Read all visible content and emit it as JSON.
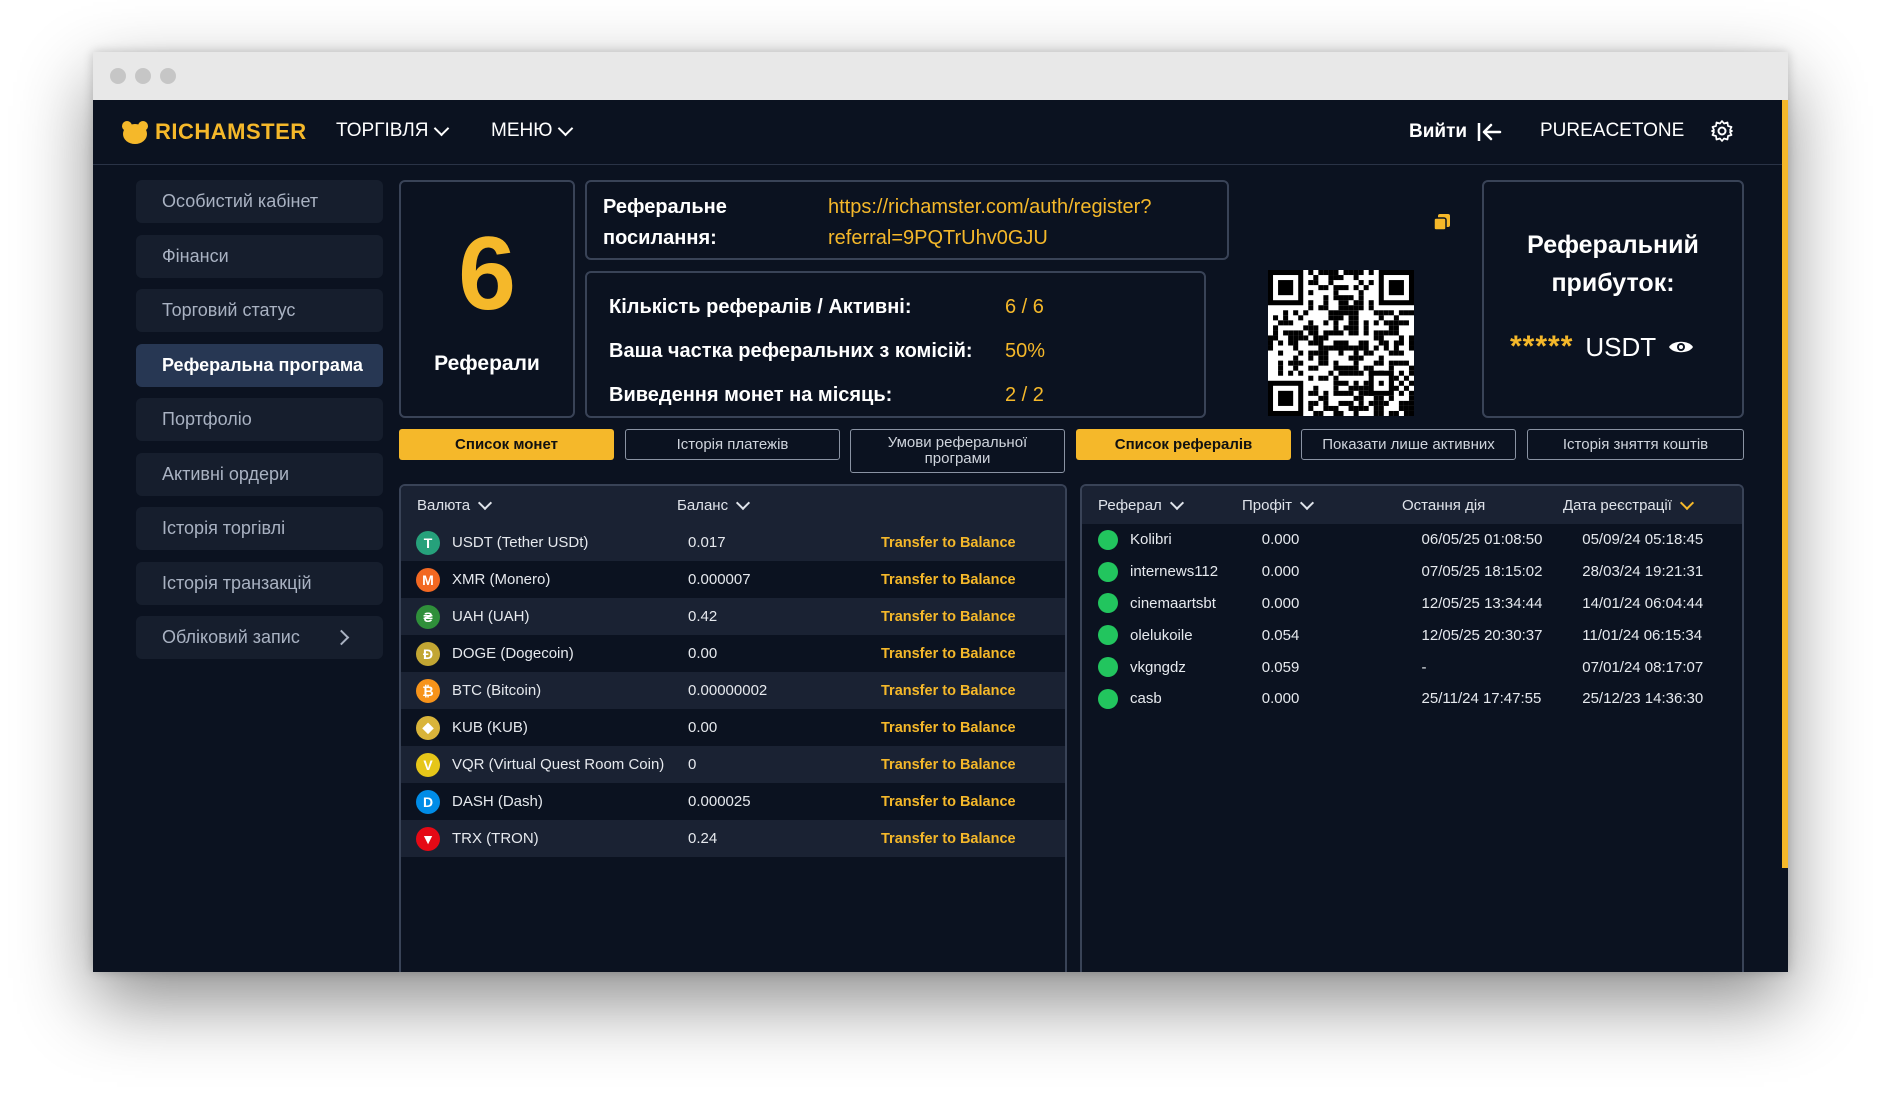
{
  "app": {
    "logo_text": "RICHAMSTER",
    "accent_color": "#f5b82a"
  },
  "nav": {
    "trading": "ТОРГІВЛЯ",
    "menu": "МЕНЮ",
    "logout": "Вийти",
    "username": "PUREACETONE"
  },
  "sidebar": {
    "items": [
      {
        "label": "Особистий кабінет"
      },
      {
        "label": "Фінанси"
      },
      {
        "label": "Торговий статус"
      },
      {
        "label": "Реферальна програма",
        "active": true
      },
      {
        "label": "Портфоліо"
      },
      {
        "label": "Активні ордери"
      },
      {
        "label": "Історія торгівлі"
      },
      {
        "label": "Історія транзакцій"
      },
      {
        "label": "Обліковий запис"
      }
    ]
  },
  "referrals_card": {
    "count": "6",
    "label": "Реферали"
  },
  "ref_link": {
    "label_line1": "Реферальне",
    "label_line2": "посилання:",
    "url_line1": "https://richamster.com/auth/register?",
    "url_line2": "referral=9PQTrUhv0GJU"
  },
  "stats": [
    {
      "label": "Кількість рефералів / Активні:",
      "value": "6 / 6"
    },
    {
      "label": "Ваша частка реферальних з комісій:",
      "value": "50%"
    },
    {
      "label": "Виведення монет на місяць:",
      "value": "2 / 2"
    }
  ],
  "profit": {
    "title_line1": "Реферальний",
    "title_line2": "прибуток:",
    "masked": "*****",
    "currency": "USDT"
  },
  "buttons": {
    "coin_list": "Список монет",
    "payment_history": "Історія платежів",
    "terms_line1": "Умови реферальної",
    "terms_line2": "програми",
    "referral_list": "Список рефералів",
    "show_active": "Показати лише активних",
    "withdraw_history": "Історія зняття коштів"
  },
  "coins_table": {
    "headers": {
      "currency": "Валюта",
      "balance": "Баланс"
    },
    "action_label": "Transfer to Balance",
    "rows": [
      {
        "name": "USDT (Tether USDt)",
        "balance": "0.017",
        "icon": "tether-icon",
        "color": "#26a17b",
        "glyph": "T"
      },
      {
        "name": "XMR (Monero)",
        "balance": "0.000007",
        "icon": "monero-icon",
        "color": "#f26822",
        "glyph": "M"
      },
      {
        "name": "UAH (UAH)",
        "balance": "0.42",
        "icon": "uah-icon",
        "color": "#2f8f3a",
        "glyph": "₴"
      },
      {
        "name": "DOGE (Dogecoin)",
        "balance": "0.00",
        "icon": "dogecoin-icon",
        "color": "#c2a633",
        "glyph": "Ð"
      },
      {
        "name": "BTC (Bitcoin)",
        "balance": "0.00000002",
        "icon": "bitcoin-icon",
        "color": "#f7931a",
        "glyph": "₿"
      },
      {
        "name": "KUB (KUB)",
        "balance": "0.00",
        "icon": "kub-icon",
        "color": "#d9b43a",
        "glyph": "◆"
      },
      {
        "name": "VQR (Virtual Quest Room Coin)",
        "balance": "0",
        "icon": "vqr-icon",
        "color": "#e6c619",
        "glyph": "V"
      },
      {
        "name": "DASH (Dash)",
        "balance": "0.000025",
        "icon": "dash-icon",
        "color": "#008ce7",
        "glyph": "D"
      },
      {
        "name": "TRX (TRON)",
        "balance": "0.24",
        "icon": "tron-icon",
        "color": "#e50915",
        "glyph": "▼"
      }
    ]
  },
  "referrals_table": {
    "headers": {
      "referral": "Реферал",
      "profit": "Профіт",
      "last_action": "Остання дія",
      "registered": "Дата реєстрації"
    },
    "rows": [
      {
        "name": "Kolibri",
        "profit": "0.000",
        "last": "06/05/25 01:08:50",
        "reg": "05/09/24 05:18:45"
      },
      {
        "name": "internews112",
        "profit": "0.000",
        "last": "07/05/25 18:15:02",
        "reg": "28/03/24 19:21:31"
      },
      {
        "name": "cinemaartsbt",
        "profit": "0.000",
        "last": "12/05/25 13:34:44",
        "reg": "14/01/24 06:04:44"
      },
      {
        "name": "olelukoile",
        "profit": "0.054",
        "last": "12/05/25 20:30:37",
        "reg": "11/01/24 06:15:34"
      },
      {
        "name": "vkgngdz",
        "profit": "0.059",
        "last": "-",
        "reg": "07/01/24 08:17:07"
      },
      {
        "name": "casb",
        "profit": "0.000",
        "last": "25/11/24 17:47:55",
        "reg": "25/12/23 14:36:30"
      }
    ]
  }
}
